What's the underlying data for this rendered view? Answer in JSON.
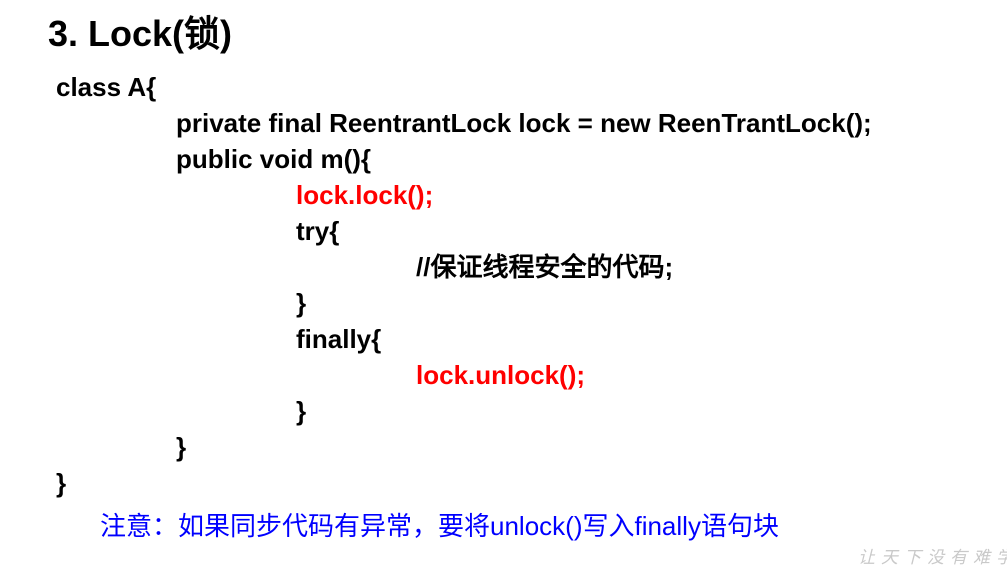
{
  "title": "3. Lock(锁)",
  "code": {
    "class_decl": "class A{",
    "field_decl": "private final ReentrantLock lock = new ReenTrantLock();",
    "method_decl": "public void m(){",
    "lock_call": "lock.lock();",
    "try_open": "try{",
    "comment": "//保证线程安全的代码;",
    "try_close": "}",
    "finally_open": "finally{",
    "unlock_call": "lock.unlock();",
    "finally_close": "}",
    "method_close": "}",
    "class_close": "}"
  },
  "note": "注意：如果同步代码有异常，要将unlock()写入finally语句块",
  "watermark": "让天下没有难学",
  "colors": {
    "text": "#000000",
    "highlight": "#ff0000",
    "note": "#0000ff"
  }
}
